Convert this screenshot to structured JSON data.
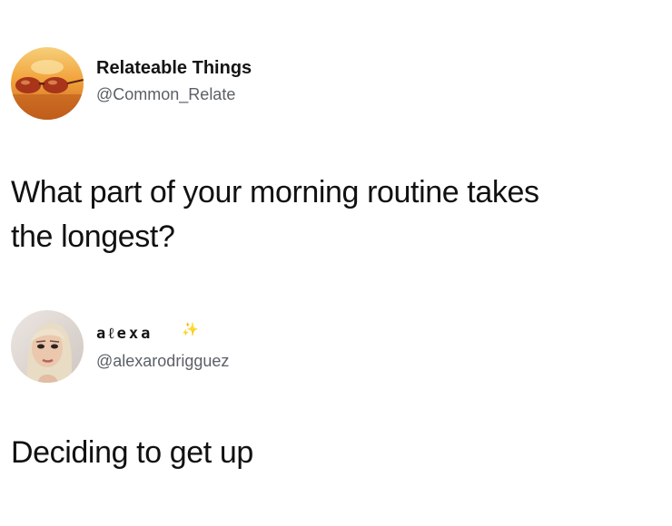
{
  "tweet": {
    "display_name": "Relateable Things",
    "handle": "@Common_Relate",
    "text_line1": "What part of your morning routine takes",
    "text_line2": "the longest?",
    "avatar_icon": "sunglasses-sunset-avatar"
  },
  "reply": {
    "display_name": "aℓexa",
    "name_emoji": "✨",
    "handle": "@alexarodrigguez",
    "text": "Deciding to get up",
    "avatar_icon": "profile-photo-avatar"
  },
  "colors": {
    "text": "#111111",
    "handle": "#5b6066",
    "background": "#ffffff",
    "sparkle": "#f1d43a"
  }
}
